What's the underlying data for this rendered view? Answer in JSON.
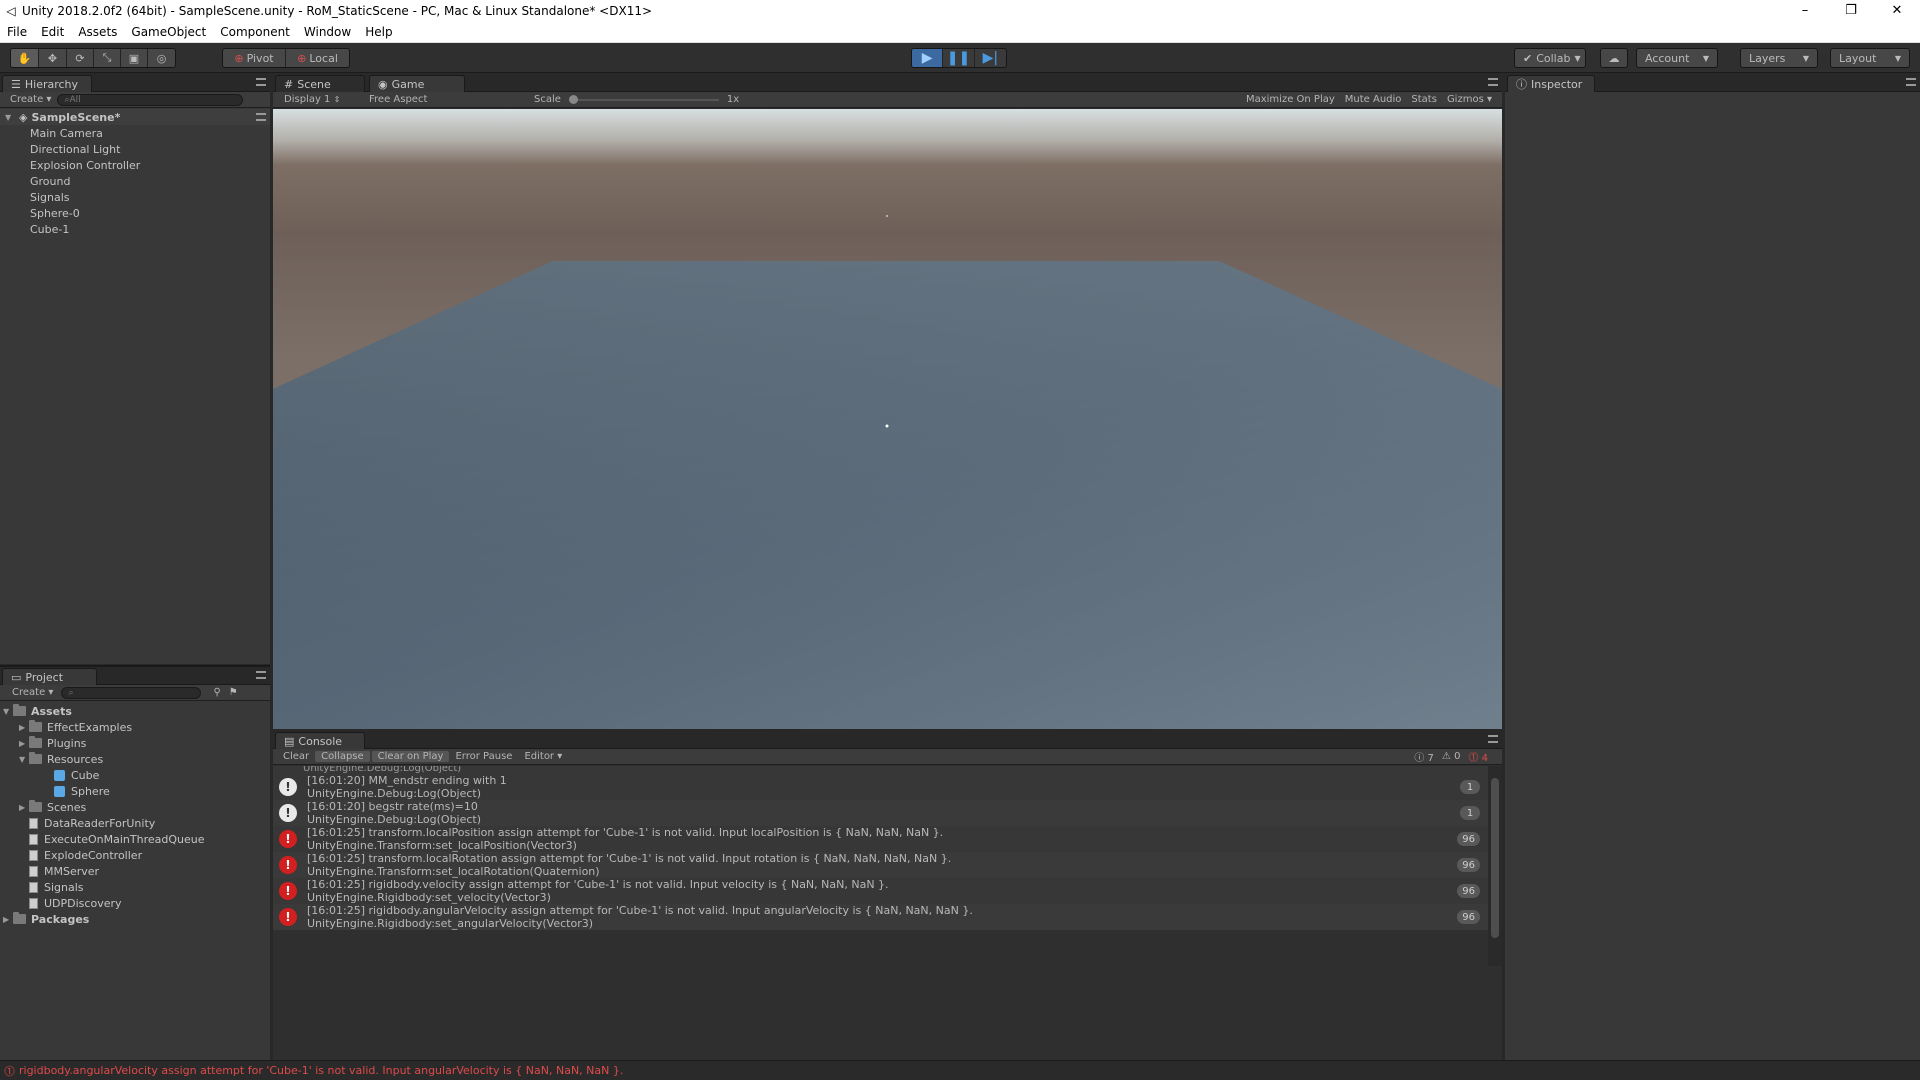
{
  "window": {
    "title": "Unity 2018.2.0f2 (64bit) - SampleScene.unity - RoM_StaticScene - PC, Mac & Linux Standalone* <DX11>",
    "minimize": "–",
    "restore": "❐",
    "close": "✕"
  },
  "menu": [
    "File",
    "Edit",
    "Assets",
    "GameObject",
    "Component",
    "Window",
    "Help"
  ],
  "toolbar": {
    "pivot": "Pivot",
    "local": "Local",
    "collab": "Collab",
    "account": "Account",
    "layers": "Layers",
    "layout": "Layout",
    "play_active": true
  },
  "hierarchy": {
    "tab": "Hierarchy",
    "create": "Create",
    "search_placeholder": "All",
    "scene": "SampleScene*",
    "items": [
      "Main Camera",
      "Directional Light",
      "Explosion Controller",
      "Ground",
      "Signals",
      "Sphere-0",
      "Cube-1"
    ]
  },
  "game": {
    "tab_scene": "Scene",
    "tab_game": "Game",
    "display": "Display 1",
    "aspect": "Free Aspect",
    "scale_label": "Scale",
    "scale_value": "1x",
    "maximize": "Maximize On Play",
    "mute": "Mute Audio",
    "stats": "Stats",
    "gizmos": "Gizmos"
  },
  "inspector": {
    "tab": "Inspector"
  },
  "project": {
    "tab": "Project",
    "create": "Create",
    "root": "Assets",
    "items": [
      {
        "label": "EffectExamples",
        "kind": "folder",
        "depth": 1,
        "expander": "▶"
      },
      {
        "label": "Plugins",
        "kind": "folder",
        "depth": 1,
        "expander": "▶"
      },
      {
        "label": "Resources",
        "kind": "folder",
        "depth": 1,
        "expander": "▼"
      },
      {
        "label": "Cube",
        "kind": "prefab",
        "depth": 2,
        "expander": ""
      },
      {
        "label": "Sphere",
        "kind": "prefab",
        "depth": 2,
        "expander": ""
      },
      {
        "label": "Scenes",
        "kind": "folder",
        "depth": 1,
        "expander": "▶"
      },
      {
        "label": "DataReaderForUnity",
        "kind": "script",
        "depth": 1,
        "expander": ""
      },
      {
        "label": "ExecuteOnMainThreadQueue",
        "kind": "script",
        "depth": 1,
        "expander": ""
      },
      {
        "label": "ExplodeController",
        "kind": "script",
        "depth": 1,
        "expander": ""
      },
      {
        "label": "MMServer",
        "kind": "script",
        "depth": 1,
        "expander": ""
      },
      {
        "label": "Signals",
        "kind": "script",
        "depth": 1,
        "expander": ""
      },
      {
        "label": "UDPDiscovery",
        "kind": "script",
        "depth": 1,
        "expander": ""
      }
    ],
    "packages": "Packages"
  },
  "console": {
    "tab": "Console",
    "buttons": [
      "Clear",
      "Collapse",
      "Clear on Play",
      "Error Pause",
      "Editor"
    ],
    "count_info": "7",
    "count_warn": "0",
    "count_error": "4",
    "partial_line": "UnityEngine.Debug:Log(Object)",
    "rows": [
      {
        "type": "info",
        "line1": "[16:01:20] MM_endstr ending with 1",
        "line2": "UnityEngine.Debug:Log(Object)",
        "count": "1"
      },
      {
        "type": "info",
        "line1": "[16:01:20] begstr rate(ms)=10",
        "line2": "UnityEngine.Debug:Log(Object)",
        "count": "1"
      },
      {
        "type": "err",
        "line1": "[16:01:25] transform.localPosition assign attempt for 'Cube-1' is not valid. Input localPosition is { NaN, NaN, NaN }.",
        "line2": "UnityEngine.Transform:set_localPosition(Vector3)",
        "count": "96"
      },
      {
        "type": "err",
        "line1": "[16:01:25] transform.localRotation assign attempt for 'Cube-1' is not valid. Input rotation is { NaN, NaN, NaN, NaN }.",
        "line2": "UnityEngine.Transform:set_localRotation(Quaternion)",
        "count": "96"
      },
      {
        "type": "err",
        "line1": "[16:01:25] rigidbody.velocity assign attempt for 'Cube-1' is not valid. Input velocity is { NaN, NaN, NaN }.",
        "line2": "UnityEngine.Rigidbody:set_velocity(Vector3)",
        "count": "96"
      },
      {
        "type": "err",
        "line1": "[16:01:25] rigidbody.angularVelocity assign attempt for 'Cube-1' is not valid. Input angularVelocity is { NaN, NaN, NaN }.",
        "line2": "UnityEngine.Rigidbody:set_angularVelocity(Vector3)",
        "count": "96"
      }
    ]
  },
  "status": {
    "message": "rigidbody.angularVelocity assign attempt for 'Cube-1' is not valid. Input angularVelocity is { NaN, NaN, NaN }."
  }
}
